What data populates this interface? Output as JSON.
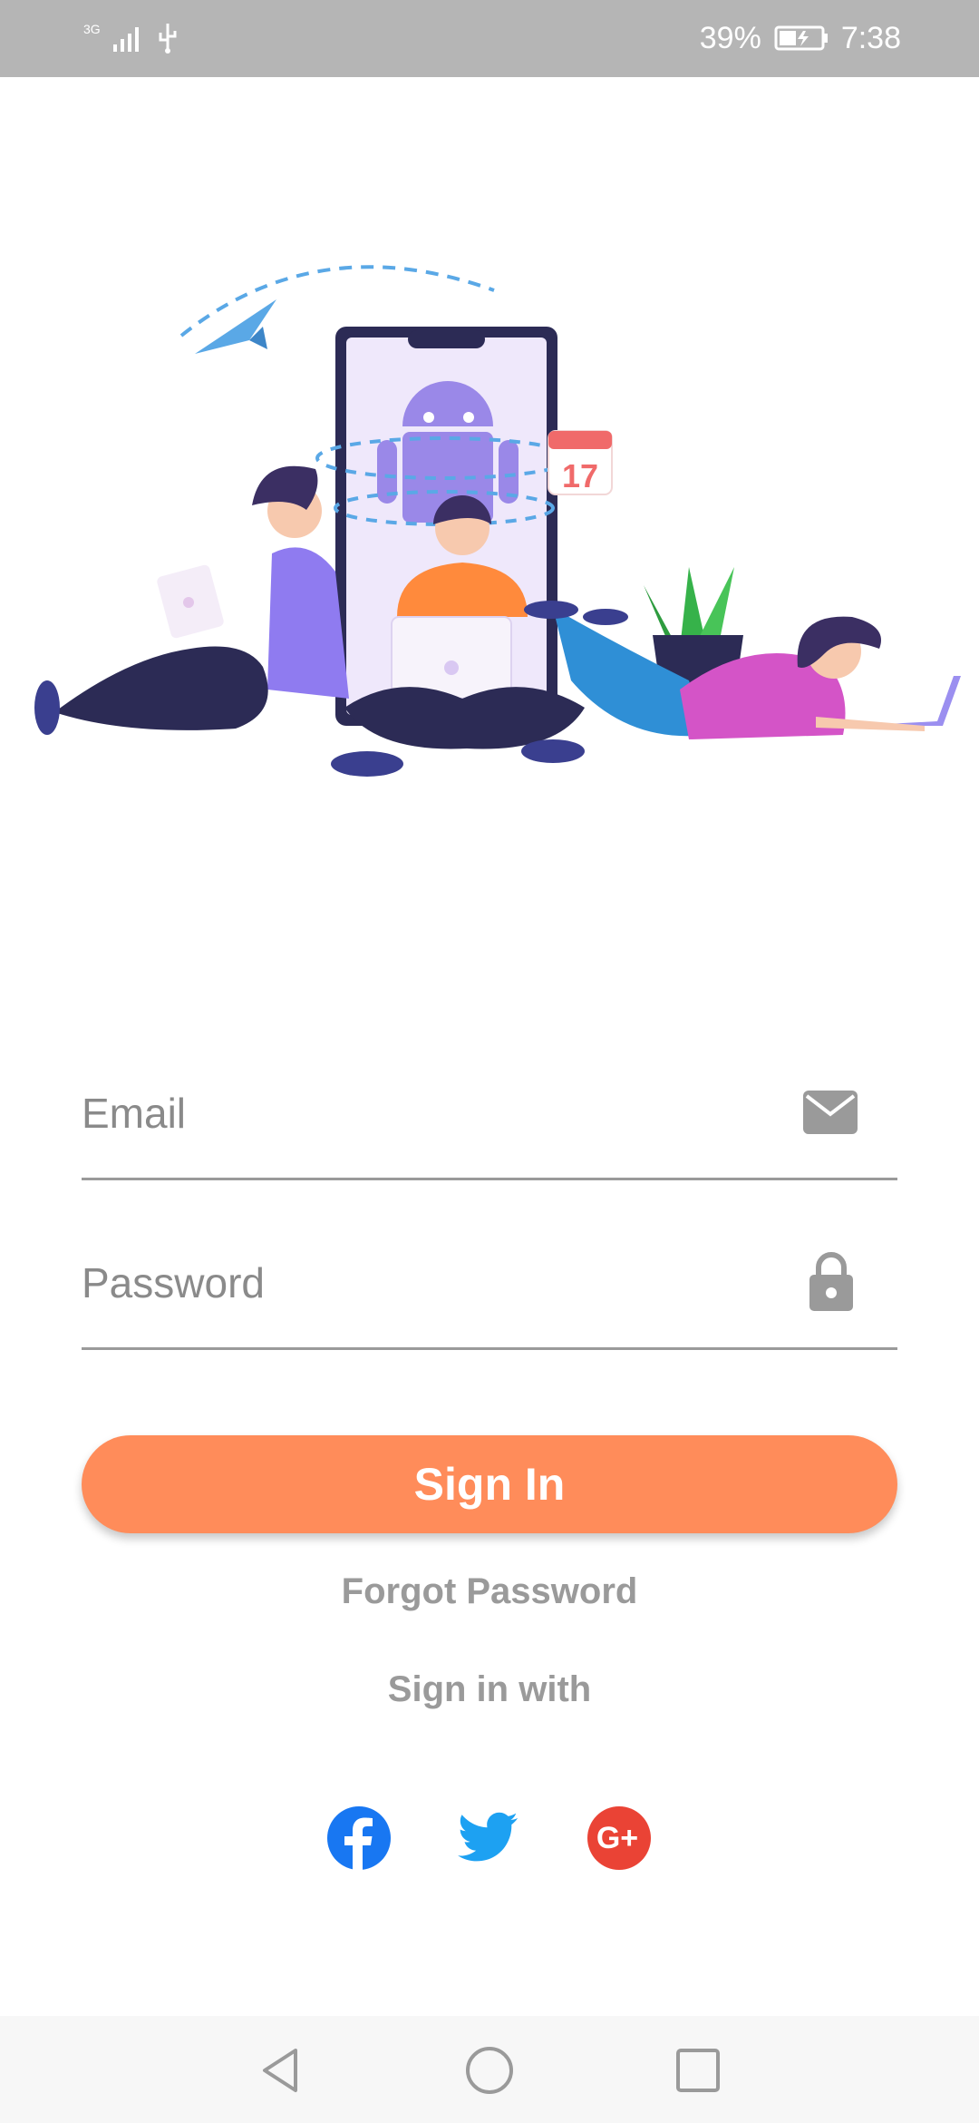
{
  "status_bar": {
    "network_label": "3G",
    "battery_percent": "39%",
    "time": "7:38",
    "icons": [
      "signal-icon",
      "usb-icon",
      "battery-icon"
    ]
  },
  "illustration": {
    "calendar_day": "17"
  },
  "form": {
    "email_placeholder": "Email",
    "password_placeholder": "Password",
    "signin_label": "Sign In",
    "forgot_label": "Forgot Password",
    "signin_with_label": "Sign in with"
  },
  "social": [
    {
      "name": "facebook-icon",
      "color": "#1877f2"
    },
    {
      "name": "twitter-icon",
      "color": "#1da1f2"
    },
    {
      "name": "google-plus-icon",
      "color": "#ea4335"
    }
  ],
  "colors": {
    "accent": "#ff8c5a",
    "status_bar": "#b5b5b5",
    "muted_text": "#9a9a9a"
  },
  "navbar": {
    "icons": [
      "back-icon",
      "home-icon",
      "recents-icon"
    ]
  }
}
